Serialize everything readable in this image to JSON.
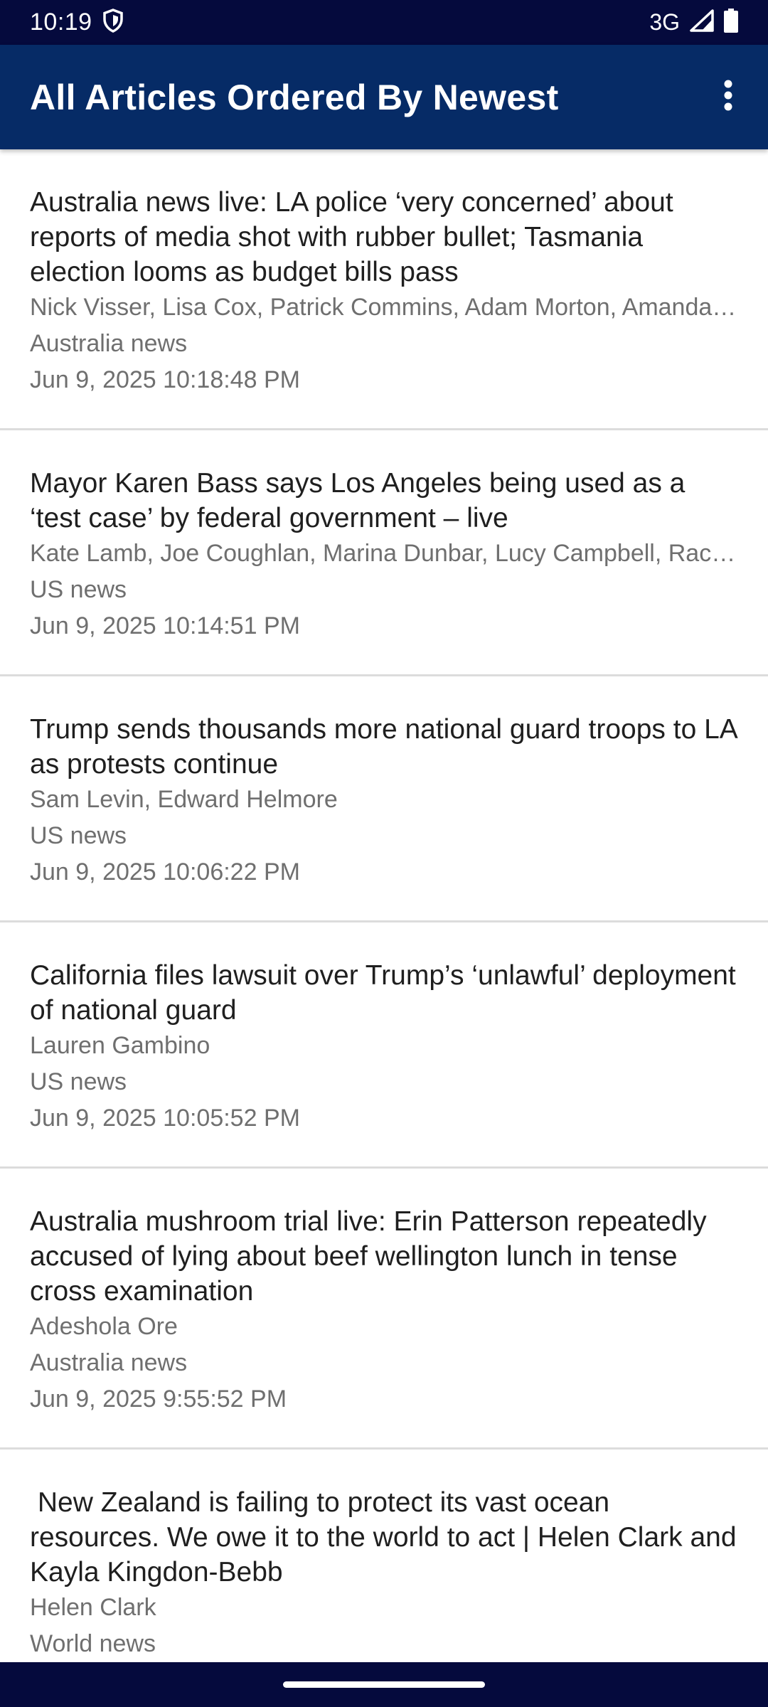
{
  "status_bar": {
    "time": "10:19",
    "network": "3G",
    "icons": [
      "shield-icon",
      "signal-icon",
      "battery-icon"
    ]
  },
  "app_bar": {
    "title": "All Articles Ordered By Newest",
    "menu_icon": "more-vertical-icon"
  },
  "colors": {
    "status_bar": "#050a3d",
    "app_bar": "#062b66",
    "title_text": "#1f1f1f",
    "meta_text": "#6f6f6f",
    "divider": "#dcdcdc"
  },
  "articles": [
    {
      "title": "Australia news live: LA police ‘very concerned’ about reports of media shot with rubber bullet; Tasmania election looms as budget bills pass",
      "authors": "Nick Visser, Lisa Cox, Patrick Commins, Adam Morton, Amanda Meade",
      "section": "Australia news",
      "date": "Jun 9, 2025 10:18:48 PM"
    },
    {
      "title": "Mayor Karen Bass says Los Angeles being used as a ‘test case’ by federal government – live",
      "authors": "Kate Lamb, Joe Coughlan, Marina Dunbar, Lucy Campbell, Rachel Leingang",
      "section": "US news",
      "date": "Jun 9, 2025 10:14:51 PM"
    },
    {
      "title": "Trump sends thousands more national guard troops to LA as protests continue",
      "authors": "Sam Levin, Edward Helmore",
      "section": "US news",
      "date": "Jun 9, 2025 10:06:22 PM"
    },
    {
      "title": "California files lawsuit over Trump’s ‘unlawful’ deployment of national guard",
      "authors": "Lauren Gambino",
      "section": "US news",
      "date": "Jun 9, 2025 10:05:52 PM"
    },
    {
      "title": "Australia mushroom trial live: Erin Patterson repeatedly accused of lying about beef wellington lunch in tense cross examination",
      "authors": "Adeshola Ore",
      "section": "Australia news",
      "date": "Jun 9, 2025 9:55:52 PM"
    },
    {
      "title": " New Zealand is failing to protect its vast ocean resources. We owe it to the world to act | Helen Clark and Kayla Kingdon-Bebb",
      "authors": "Helen Clark",
      "section": "World news",
      "date": ""
    }
  ]
}
